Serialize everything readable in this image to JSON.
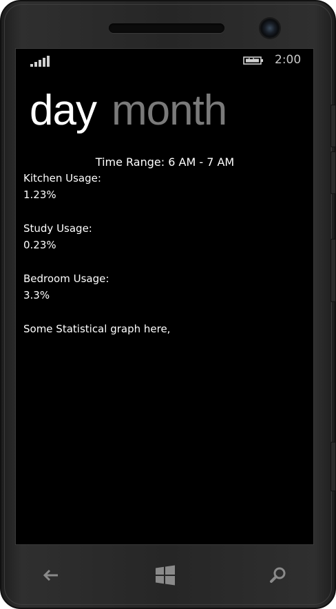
{
  "status_bar": {
    "signal_icon": "signal-strength-icon",
    "battery_icon": "battery-charging-icon",
    "time": "2:00"
  },
  "pivot": {
    "items": [
      {
        "label": "day",
        "active": true
      },
      {
        "label": "month",
        "active": false
      }
    ]
  },
  "content": {
    "time_range": "Time Range: 6 AM - 7 AM",
    "usages": [
      {
        "label": "Kitchen Usage:",
        "value": "1.23%"
      },
      {
        "label": "Study Usage:",
        "value": "0.23%"
      },
      {
        "label": "Bedroom Usage:",
        "value": "3.3%"
      }
    ],
    "graph_placeholder": "Some Statistical graph here,"
  },
  "hardware_buttons": {
    "back_icon": "back-arrow-icon",
    "start_icon": "windows-logo-icon",
    "search_icon": "search-icon"
  },
  "colors": {
    "screen_background": "#000000",
    "active_text": "#ffffff",
    "inactive_text": "#7a7a7a",
    "bezel": "#262626"
  }
}
